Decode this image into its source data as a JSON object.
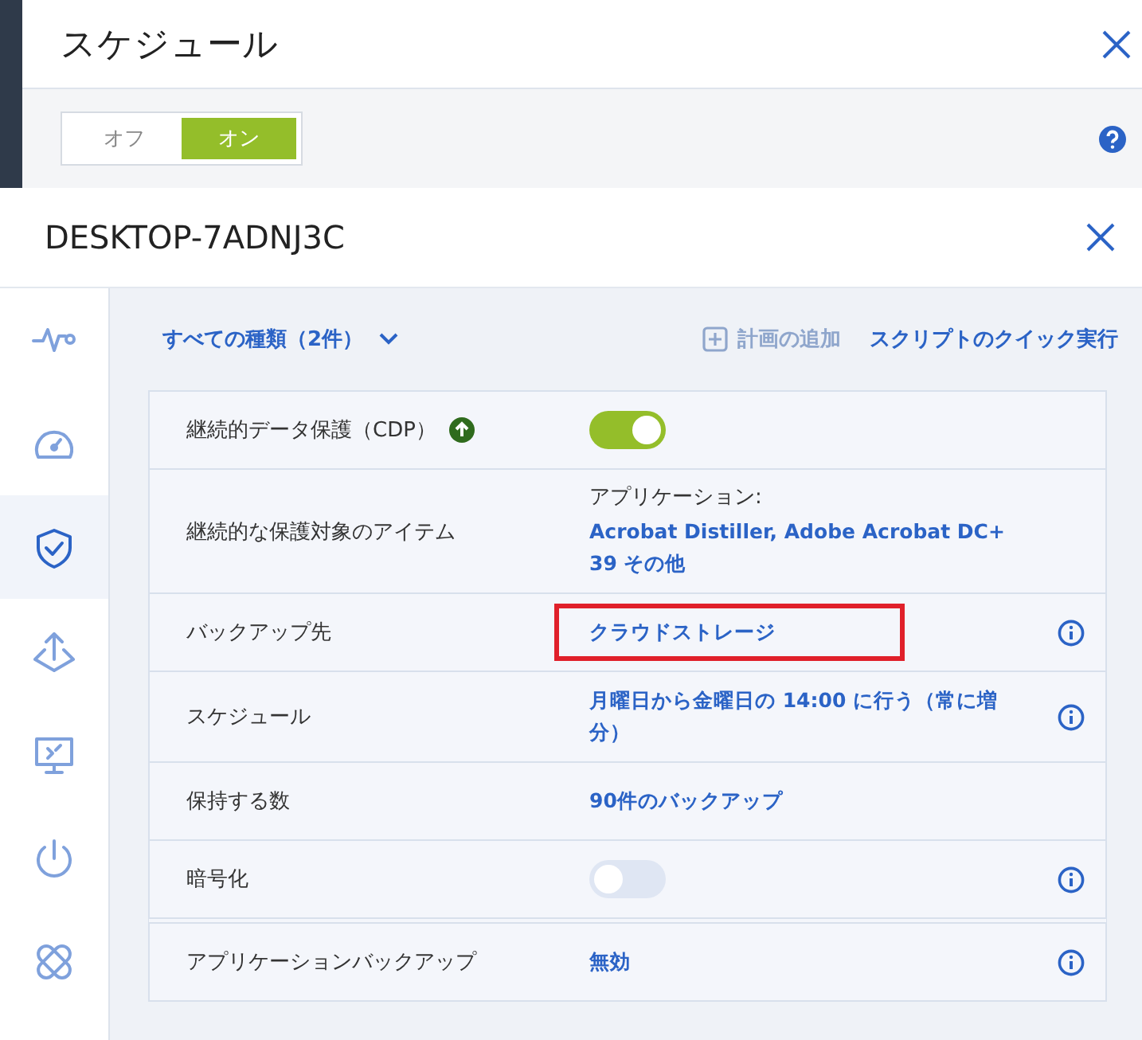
{
  "back_dialog": {
    "title": "スケジュール",
    "switch": [
      {
        "label": "オフ",
        "selected": false
      },
      {
        "label": "オン",
        "selected": true
      }
    ]
  },
  "panel": {
    "title": "DESKTOP-7ADNJ3C",
    "rail": [
      {
        "selected": false
      },
      {
        "selected": false
      },
      {
        "selected": true
      },
      {
        "selected": false
      },
      {
        "selected": false
      },
      {
        "selected": false
      },
      {
        "selected": false
      }
    ],
    "toolbar": {
      "filter": "すべての種類（2件）",
      "add_plan": {
        "label": "計画の追加",
        "disabled": true
      },
      "quick_script": "スクリプトのクイック実行"
    },
    "rows": [
      {
        "label": "継続的データ保護（CDP）",
        "badge": true,
        "kind": "toggle",
        "on": true,
        "info": false
      },
      {
        "label": "継続的な保護対象のアイテム",
        "kind": "items",
        "caption": "アプリケーション:",
        "value": "Acrobat Distiller, Adobe Acrobat DC+ 39 その他",
        "info": false
      },
      {
        "label": "バックアップ先",
        "kind": "link",
        "value": "クラウドストレージ",
        "info": true,
        "highlighted": true
      },
      {
        "label": "スケジュール",
        "kind": "link",
        "value": "月曜日から金曜日の 14:00 に行う（常に増分）",
        "info": true
      },
      {
        "label": "保持する数",
        "kind": "link",
        "value": "90件のバックアップ",
        "info": false
      },
      {
        "label": "暗号化",
        "kind": "toggle",
        "on": false,
        "info": true,
        "group_end": true
      },
      {
        "label": "アプリケーションバックアップ",
        "kind": "link",
        "value": "無効",
        "info": true
      }
    ]
  }
}
